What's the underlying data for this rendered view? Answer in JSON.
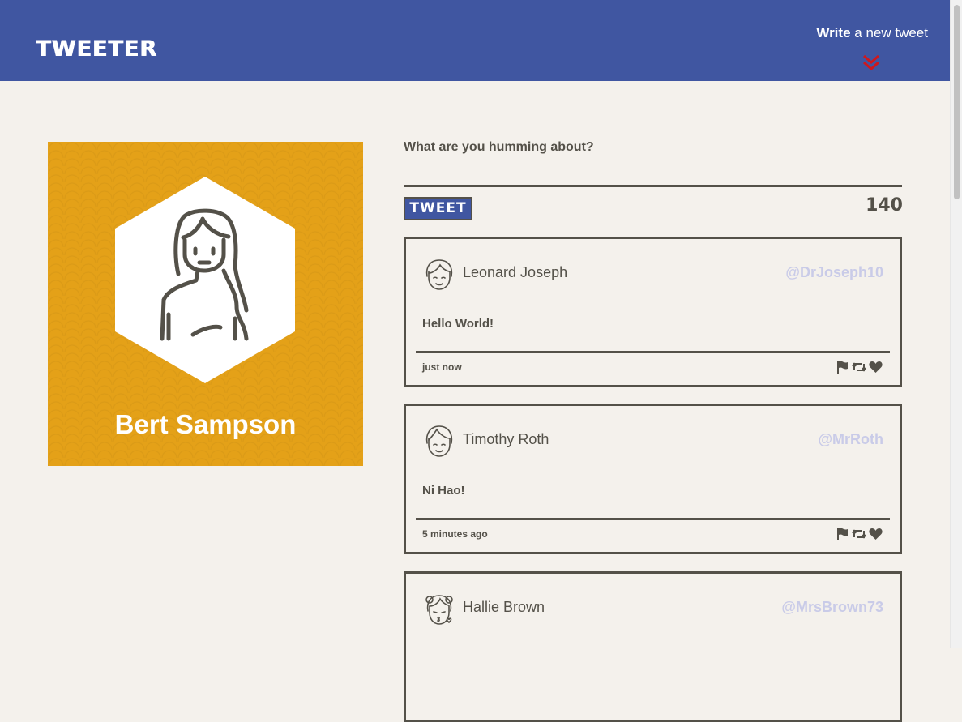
{
  "nav": {
    "brand": "TWEETER",
    "write_bold": "Write",
    "write_rest": "a new tweet"
  },
  "profile": {
    "name": "Bert Sampson"
  },
  "composer": {
    "label": "What are you humming about?",
    "value": "",
    "button_label": "TWEET",
    "counter": "140"
  },
  "tweets": [
    {
      "name": "Leonard Joseph",
      "handle": "@DrJoseph10",
      "content": "Hello World!",
      "time": "just now"
    },
    {
      "name": "Timothy Roth",
      "handle": "@MrRoth",
      "content": "Ni Hao!",
      "time": "5 minutes ago"
    },
    {
      "name": "Hallie Brown",
      "handle": "@MrsBrown73",
      "content": "",
      "time": ""
    }
  ],
  "colors": {
    "navbar": "#4056a1",
    "profile_bg": "#e4a118",
    "text": "#545149",
    "handle": "#c9cbe8",
    "chevron": "#d0171b",
    "page_bg": "#f4f1ec"
  }
}
